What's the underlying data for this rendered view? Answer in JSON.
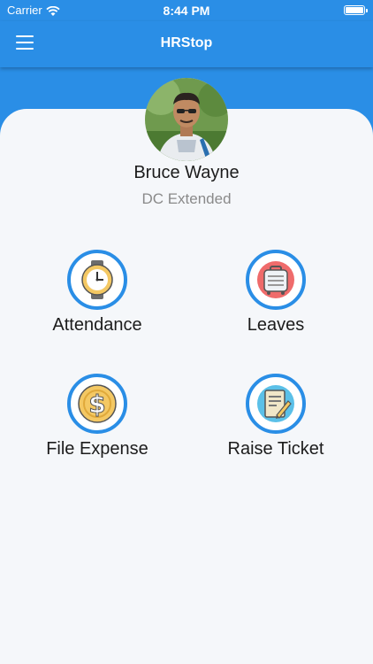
{
  "status_bar": {
    "carrier": "Carrier",
    "time": "8:44 PM"
  },
  "app_bar": {
    "title": "HRStop",
    "menu_icon": "hamburger-menu-icon"
  },
  "profile": {
    "name": "Bruce Wayne",
    "subtitle": "DC Extended"
  },
  "tiles": [
    {
      "label": "Attendance",
      "icon": "clock-icon"
    },
    {
      "label": "Leaves",
      "icon": "luggage-icon"
    },
    {
      "label": "File Expense",
      "icon": "dollar-icon"
    },
    {
      "label": "Raise Ticket",
      "icon": "ticket-note-icon"
    }
  ],
  "colors": {
    "primary": "#2a8ee6",
    "background": "#f5f7fa"
  }
}
